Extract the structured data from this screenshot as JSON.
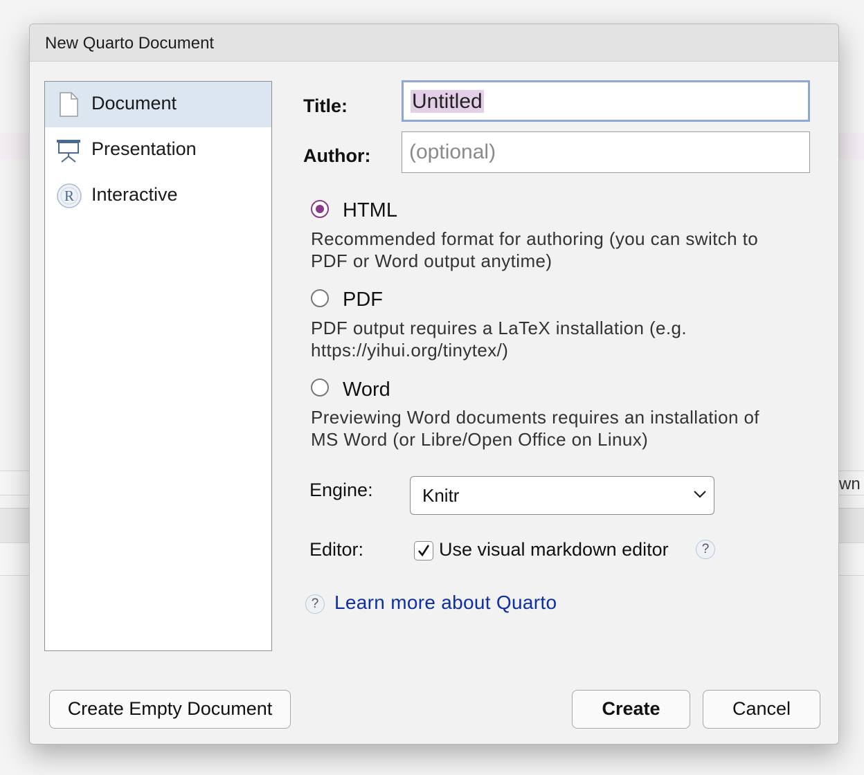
{
  "background": {
    "partial_text": "wn"
  },
  "dialog": {
    "title": "New Quarto Document"
  },
  "sidebar": {
    "items": [
      {
        "label": "Document",
        "icon": "document-icon",
        "selected": true
      },
      {
        "label": "Presentation",
        "icon": "presentation-icon",
        "selected": false
      },
      {
        "label": "Interactive",
        "icon": "r-logo-icon",
        "selected": false
      }
    ]
  },
  "form": {
    "title_label": "Title:",
    "title_value": "Untitled",
    "author_label": "Author:",
    "author_placeholder": "(optional)"
  },
  "formats": [
    {
      "label": "HTML",
      "selected": true,
      "desc_line1": "Recommended format for authoring (you can switch to",
      "desc_line2": "PDF or Word output anytime)"
    },
    {
      "label": "PDF",
      "selected": false,
      "desc_line1": "PDF output requires a LaTeX installation (e.g.",
      "desc_line2": "https://yihui.org/tinytex/)"
    },
    {
      "label": "Word",
      "selected": false,
      "desc_line1": "Previewing Word documents requires an installation of",
      "desc_line2": "MS Word (or Libre/Open Office on Linux)"
    }
  ],
  "engine": {
    "label": "Engine:",
    "value": "Knitr"
  },
  "editor": {
    "label": "Editor:",
    "checkbox_label": "Use visual markdown editor",
    "checked": true,
    "help_glyph": "?"
  },
  "learn_more": {
    "help_glyph": "?",
    "text": "Learn more about Quarto"
  },
  "buttons": {
    "create_empty": "Create Empty Document",
    "create": "Create",
    "cancel": "Cancel"
  },
  "colors": {
    "accent_radio": "#8a3a8c",
    "selection_highlight": "#e3cfe7",
    "sidebar_selected": "#dce6f1",
    "link": "#0d2fa5",
    "focus_ring": "#8ea7d3"
  }
}
